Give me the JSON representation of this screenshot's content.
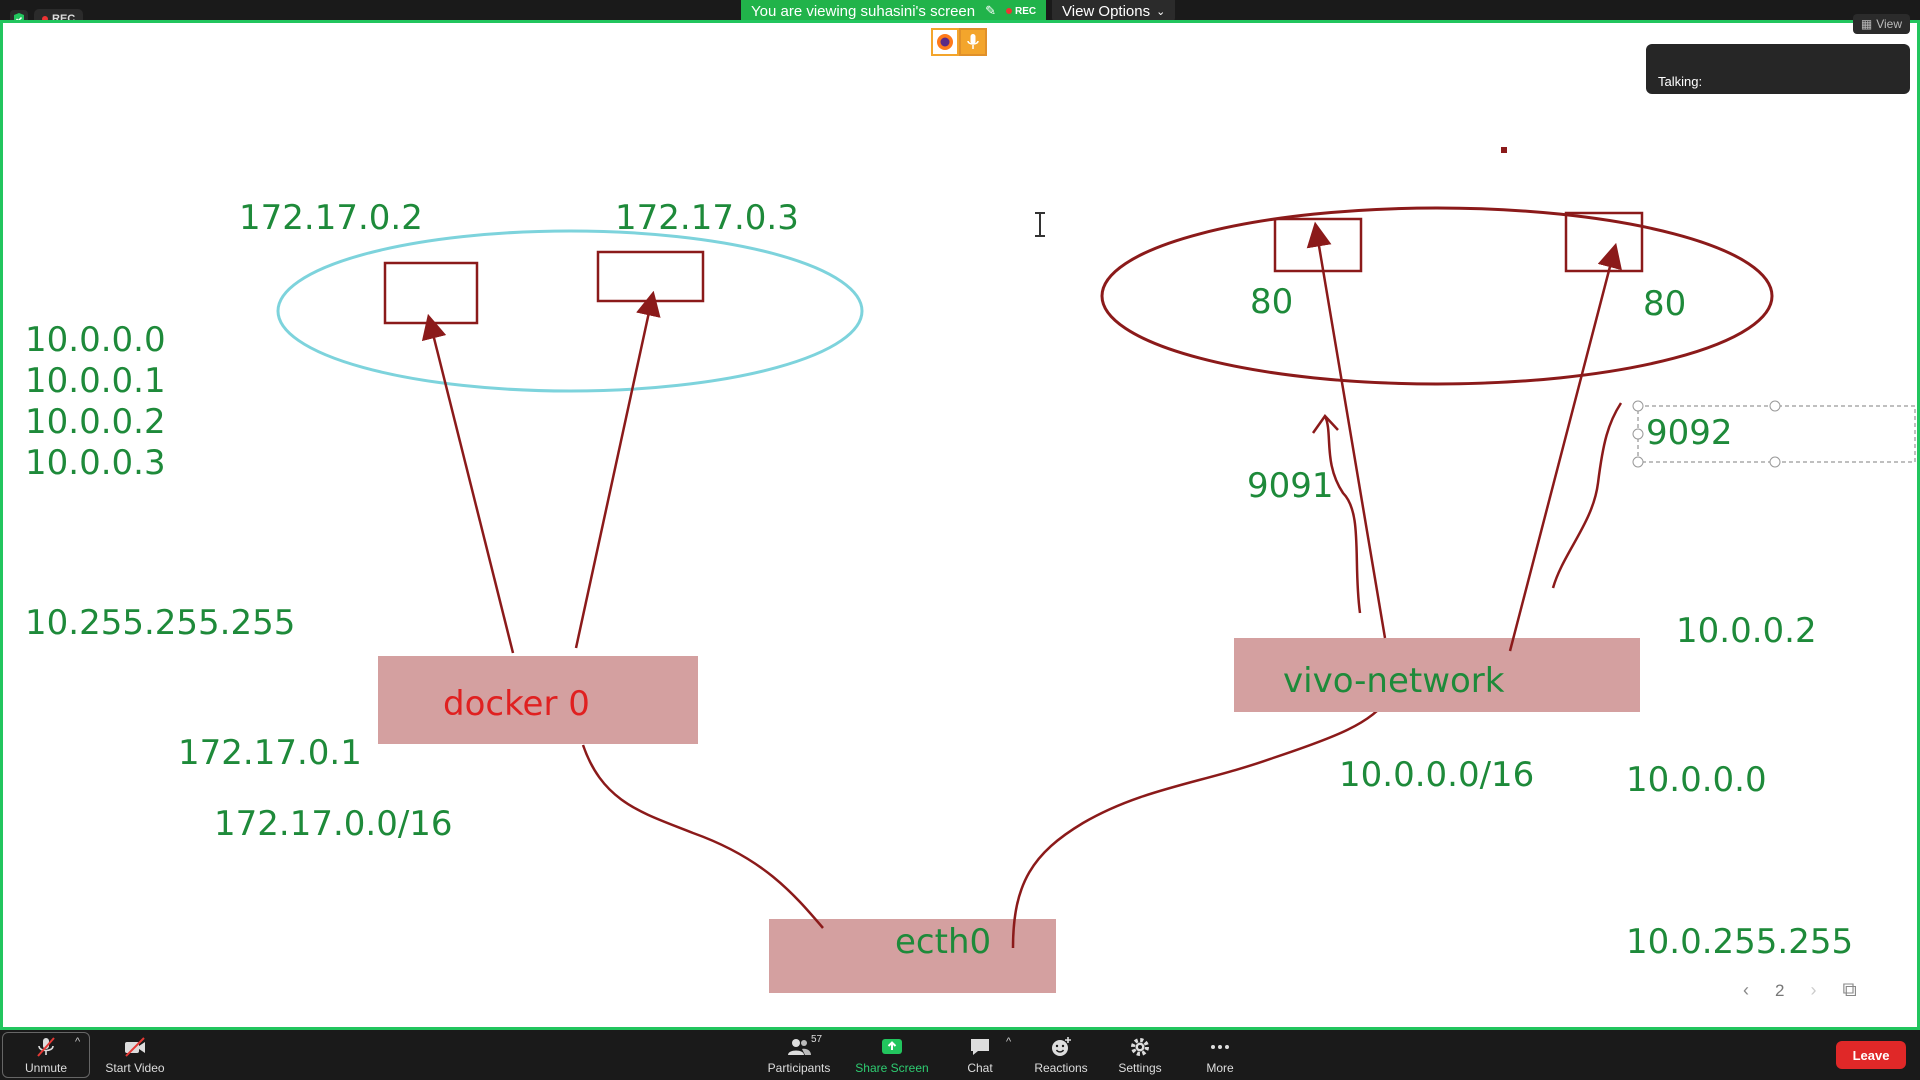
{
  "top_bar": {
    "rec_label": "REC",
    "viewing_text": "You are viewing suhasini's screen",
    "viewing_rec": "REC",
    "view_options": "View Options",
    "view_label": "View"
  },
  "talking_label": "Talking:",
  "board": {
    "left_ips": [
      "10.0.0.0",
      "10.0.0.1",
      "10.0.0.2",
      "10.0.0.3"
    ],
    "broadcast_left": "10.255.255.255",
    "container_ip_1": "172.17.0.2",
    "container_ip_2": "172.17.0.3",
    "docker_label": "docker 0",
    "docker_ip": "172.17.0.1",
    "docker_subnet": "172.17.0.0/16",
    "ecth_label": "ecth0",
    "port_left": "80",
    "port_right": "80",
    "host_port_1": "9091",
    "host_port_2": "9092",
    "vivo_label": "vivo-network",
    "vivo_subnet": "10.0.0.0/16",
    "right_ip_1": "10.0.0.2",
    "right_ip_2": "10.0.0.0",
    "right_broadcast": "10.0.255.255"
  },
  "page_nav": {
    "page": "2"
  },
  "toolbar": {
    "unmute": "Unmute",
    "start_video": "Start Video",
    "participants": "Participants",
    "participants_count": "57",
    "share_screen": "Share Screen",
    "chat": "Chat",
    "reactions": "Reactions",
    "settings": "Settings",
    "more": "More",
    "leave": "Leave"
  },
  "colors": {
    "share_border": "#22c55e",
    "label_green": "#1e8a3a",
    "arrow_red": "#8b1a1a",
    "box_fill": "#d4a0a0",
    "cyan_ellipse": "#7dd3dc",
    "leave_red": "#e02828"
  }
}
